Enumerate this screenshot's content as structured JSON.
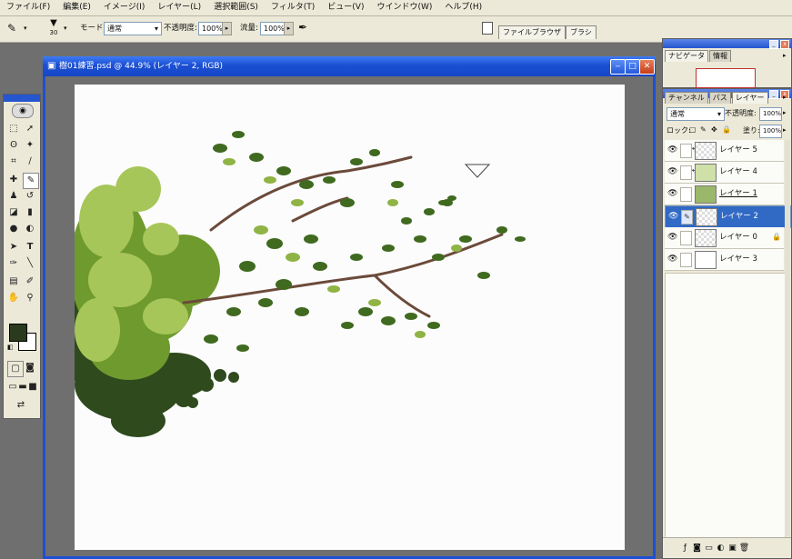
{
  "menu": [
    "ファイル(F)",
    "編集(E)",
    "イメージ(I)",
    "レイヤー(L)",
    "選択範囲(S)",
    "フィルタ(T)",
    "ビュー(V)",
    "ウインドウ(W)",
    "ヘルプ(H)"
  ],
  "options": {
    "brush_size": "30",
    "mode_label": "モード:",
    "mode_value": "通常",
    "opacity_label": "不透明度:",
    "opacity_value": "100%",
    "flow_label": "流量:",
    "flow_value": "100%",
    "well_tabs": [
      "ファイルブラウザ",
      "ブラシ"
    ]
  },
  "document": {
    "title": "樹01練習.psd @ 44.9% (レイヤー 2, RGB)"
  },
  "navigator_panel": {
    "tabs": [
      "ナビゲータ",
      "情報"
    ]
  },
  "layers_panel": {
    "tabs": [
      "チャンネル",
      "パス",
      "レイヤー"
    ],
    "blend_mode": "通常",
    "opacity_label": "不透明度:",
    "opacity_value": "100%",
    "lock_label": "ロック:",
    "fill_label": "塗り:",
    "fill_value": "100%",
    "layers": [
      {
        "name": "レイヤー 5",
        "thumb": "leaf"
      },
      {
        "name": "レイヤー 4",
        "thumb": "leaf"
      },
      {
        "name": "レイヤー 1",
        "thumb": "leaf"
      },
      {
        "name": "レイヤー 2",
        "thumb": "branch",
        "selected": true
      },
      {
        "name": "レイヤー 0",
        "thumb": "blank",
        "locked": true
      },
      {
        "name": "レイヤー 3",
        "thumb": "white"
      }
    ]
  },
  "colors": {
    "foreground": "#2a3a1c",
    "background": "#ffffff",
    "title_bar": "#1b4fd3"
  }
}
